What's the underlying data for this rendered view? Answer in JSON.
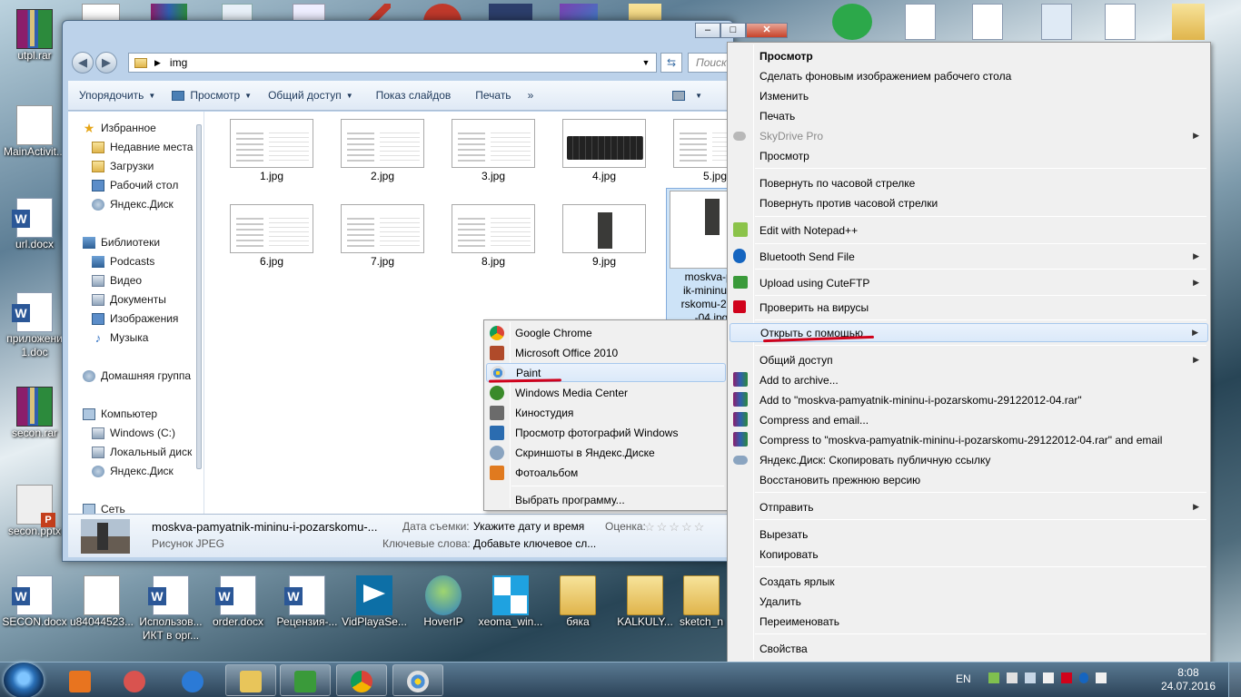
{
  "desktop": {
    "icons_left": [
      {
        "label": "utpl.rar",
        "icon": "winrar-icon"
      },
      {
        "label": "MainActivit...",
        "icon": "document-icon"
      },
      {
        "label": "url.docx",
        "icon": "word-document-icon"
      },
      {
        "label": "приложени 1.doc",
        "icon": "word-document-icon"
      },
      {
        "label": "secon.rar",
        "icon": "winrar-icon"
      },
      {
        "label": "secon.pptx",
        "icon": "powerpoint-icon"
      }
    ],
    "icons_bottom": [
      {
        "label": "SECON.docx",
        "icon": "word-document-icon"
      },
      {
        "label": "u84044523...",
        "icon": "document-icon"
      },
      {
        "label": "Использов... ИКТ  в орг...",
        "icon": "word-document-icon"
      },
      {
        "label": "order.docx",
        "icon": "word-document-icon"
      },
      {
        "label": "Рецензия-...",
        "icon": "word-document-icon"
      },
      {
        "label": "VidPlayaSe...",
        "icon": "vidplaya-icon"
      },
      {
        "label": "HoverIP",
        "icon": "hoverip-icon"
      },
      {
        "label": "xeoma_win...",
        "icon": "xeoma-icon"
      },
      {
        "label": "бяка",
        "icon": "folder-icon"
      },
      {
        "label": "KALKULY...",
        "icon": "folder-icon"
      },
      {
        "label": "sketch_n",
        "icon": "folder-icon"
      }
    ]
  },
  "explorer": {
    "address": {
      "path": "img",
      "search_placeholder": "Поиск"
    },
    "caption": {
      "minimize": "–",
      "maximize": "□",
      "close": "✕"
    },
    "toolbar": {
      "organize": "Упорядочить",
      "view": "Просмотр",
      "share": "Общий доступ",
      "slideshow": "Показ слайдов",
      "print": "Печать"
    },
    "nav": {
      "favorites": "Избранное",
      "recent": "Недавние места",
      "downloads": "Загрузки",
      "desktop": "Рабочий стол",
      "yandex_disk": "Яндекс.Диск",
      "libraries": "Библиотеки",
      "podcasts": "Podcasts",
      "video": "Видео",
      "documents": "Документы",
      "images": "Изображения",
      "music": "Музыка",
      "homegroup": "Домашняя группа",
      "computer": "Компьютер",
      "drive_c": "Windows (C:)",
      "local_disk": "Локальный диск",
      "yandex_disk_2": "Яндекс.Диск",
      "network": "Сеть"
    },
    "files": [
      {
        "name": "1.jpg"
      },
      {
        "name": "2.jpg"
      },
      {
        "name": "3.jpg"
      },
      {
        "name": "4.jpg"
      },
      {
        "name": "5.jpg"
      },
      {
        "name": "6.jpg"
      },
      {
        "name": "7.jpg"
      },
      {
        "name": "8.jpg"
      },
      {
        "name": "9.jpg"
      },
      {
        "name": "moskva-pa ik-mininu-... rskomu-29... -04.jpg"
      }
    ],
    "details": {
      "filename": "moskva-pamyatnik-mininu-i-pozarskomu-...",
      "type": "Рисунок JPEG",
      "date_label": "Дата съемки:",
      "date_value": "Укажите дату и время",
      "rating_label": "Оценка:",
      "rating_stars": "☆☆☆☆☆",
      "keywords_label": "Ключевые слова:",
      "keywords_value": "Добавьте ключевое сл..."
    }
  },
  "open_with_menu": {
    "items": [
      {
        "label": "Google Chrome",
        "icon": "chrome-icon",
        "color": "#db4437"
      },
      {
        "label": "Microsoft Office 2010",
        "icon": "office-picture-icon",
        "color": "#b04a2a"
      },
      {
        "label": "Paint",
        "icon": "paint-icon",
        "color": "#4a8fd6"
      },
      {
        "label": "Windows Media Center",
        "icon": "media-center-icon",
        "color": "#3a8a2a"
      },
      {
        "label": "Киностудия",
        "icon": "movie-maker-icon",
        "color": "#6b6b6b"
      },
      {
        "label": "Просмотр фотографий Windows",
        "icon": "photo-viewer-icon",
        "color": "#2b6cb0"
      },
      {
        "label": "Скриншоты в Яндекс.Диске",
        "icon": "yandex-screenshot-icon",
        "color": "#8aa4c0"
      },
      {
        "label": "Фотоальбом",
        "icon": "photo-gallery-icon",
        "color": "#e07a1f"
      }
    ],
    "choose": "Выбрать программу..."
  },
  "context_menu": {
    "items": [
      {
        "label": "Просмотр",
        "bold": true
      },
      {
        "label": "Сделать фоновым изображением рабочего стола"
      },
      {
        "label": "Изменить"
      },
      {
        "label": "Печать"
      },
      {
        "label": "SkyDrive Pro",
        "disabled": true,
        "submenu": true
      },
      {
        "label": "Просмотр"
      },
      {
        "label": "Повернуть по часовой стрелке"
      },
      {
        "label": "Повернуть против часовой стрелки"
      },
      {
        "label": "Edit with Notepad++"
      },
      {
        "label": "Bluetooth Send File",
        "submenu": true
      },
      {
        "label": "Upload using CuteFTP",
        "submenu": true
      },
      {
        "label": "Проверить на вирусы"
      },
      {
        "label": "Открыть с помощью",
        "submenu": true
      },
      {
        "label": "Общий доступ",
        "submenu": true
      },
      {
        "label": "Add to archive..."
      },
      {
        "label": "Add to \"moskva-pamyatnik-mininu-i-pozarskomu-29122012-04.rar\""
      },
      {
        "label": "Compress and email..."
      },
      {
        "label": "Compress to \"moskva-pamyatnik-mininu-i-pozarskomu-29122012-04.rar\" and email"
      },
      {
        "label": "Яндекс.Диск: Скопировать публичную ссылку"
      },
      {
        "label": "Восстановить прежнюю версию"
      },
      {
        "label": "Отправить",
        "submenu": true
      },
      {
        "label": "Вырезать"
      },
      {
        "label": "Копировать"
      },
      {
        "label": "Создать ярлык"
      },
      {
        "label": "Удалить"
      },
      {
        "label": "Переименовать"
      },
      {
        "label": "Свойства"
      }
    ]
  },
  "taskbar": {
    "language": "EN",
    "time": "8:08",
    "date": "24.07.2016",
    "pinned": [
      {
        "icon": "media-player-icon",
        "color": "#e8741f"
      },
      {
        "icon": "snipping-tool-icon",
        "color": "#d9534f"
      },
      {
        "icon": "internet-explorer-icon",
        "color": "#2b7ad6"
      },
      {
        "icon": "explorer-icon",
        "color": "#e8c55a"
      },
      {
        "icon": "cuteftp-icon",
        "color": "#3a9a3a"
      },
      {
        "icon": "chrome-icon",
        "color": "#db4437"
      },
      {
        "icon": "paint-icon",
        "color": "#4a8fd6"
      }
    ]
  }
}
